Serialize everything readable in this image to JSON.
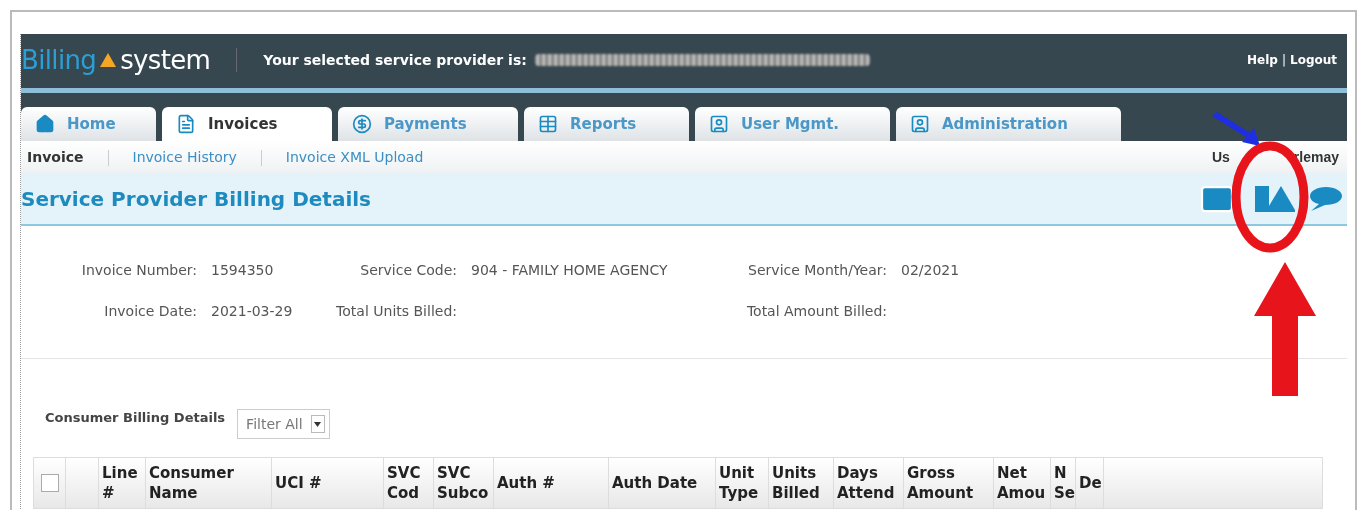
{
  "header": {
    "logo_text": "Billing",
    "logo_suffix": "system",
    "provider_label": "Your selected service provider is:",
    "links": [
      "Help",
      "Logout"
    ],
    "separator": "|"
  },
  "tabs": [
    {
      "label": "Home",
      "selected": false
    },
    {
      "label": "Invoices",
      "selected": true
    },
    {
      "label": "Payments",
      "selected": false
    },
    {
      "label": "Reports",
      "selected": false
    },
    {
      "label": "User Mgmt.",
      "selected": false
    },
    {
      "label": "Administration",
      "selected": false
    }
  ],
  "subnav": [
    {
      "label": "Invoice",
      "selected": true
    },
    {
      "label": "Invoice History",
      "selected": false
    },
    {
      "label": "Invoice XML Upload",
      "selected": false
    }
  ],
  "user": {
    "start": "Us",
    "end": "rlemay"
  },
  "page_title": "Service Provider Billing Details",
  "info": [
    [
      {
        "label": "Invoice Number:",
        "value": "1594350"
      },
      {
        "label": "Service Code:",
        "value": "904 - FAMILY HOME AGENCY"
      },
      {
        "label": "Service Month/Year:",
        "value": "02/2021"
      }
    ],
    [
      {
        "label": "Invoice Date:",
        "value": "2021-03-29"
      },
      {
        "label": "Total Units Billed:"
      },
      {
        "label": "Total Amount Billed:"
      }
    ]
  ],
  "consumer_section": {
    "title": "Consumer Billing Details",
    "filter": "Filter All"
  },
  "table": {
    "select_all_checked": false,
    "columns": [
      "Line #",
      "Consumer Name",
      "UCI #",
      "SVC Cod",
      "SVC Subco",
      "Auth #",
      "Auth Date",
      "Unit Type",
      "Units Billed",
      "Days Attend",
      "Gross Amount",
      "Net Amou",
      "N Se",
      "De"
    ]
  }
}
